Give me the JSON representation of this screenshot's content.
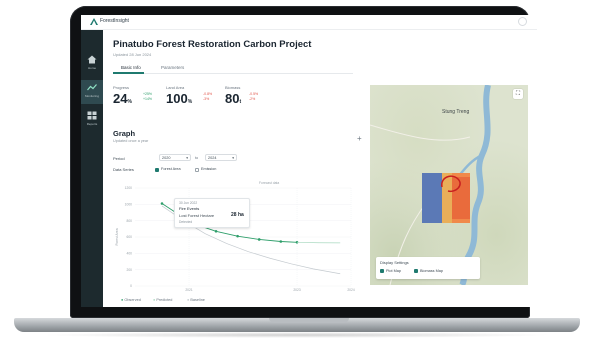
{
  "app": {
    "brand": "ForestInsight",
    "nav": [
      {
        "label": "Home",
        "icon": "home-icon",
        "active": false
      },
      {
        "label": "Monitoring",
        "icon": "chart-icon",
        "active": true
      },
      {
        "label": "Reports",
        "icon": "grid-icon",
        "active": false
      }
    ]
  },
  "project": {
    "title": "Pinatubo Forest Restoration Carbon Project",
    "updated": "Updated 28 Jun 2024"
  },
  "tabs": [
    {
      "label": "Basic Info",
      "active": true
    },
    {
      "label": "Parameters",
      "active": false
    }
  ],
  "metrics": [
    {
      "label": "Progress",
      "value": "24",
      "unit": "%",
      "deltas": [
        {
          "text": "+25%",
          "dir": "up"
        },
        {
          "text": "+14%",
          "dir": "up"
        }
      ]
    },
    {
      "label": "Land Area",
      "value": "100",
      "unit": "%",
      "deltas": [
        {
          "text": "-0.8%",
          "dir": "down"
        },
        {
          "text": "-3%",
          "dir": "down"
        }
      ]
    },
    {
      "label": "Biomass",
      "value": "80",
      "unit": "t",
      "deltas": [
        {
          "text": "-0.5%",
          "dir": "down"
        },
        {
          "text": "-2%",
          "dir": "down"
        }
      ]
    }
  ],
  "graph": {
    "title": "Graph",
    "subtitle": "Updated once a year",
    "add_label": "+",
    "period_label": "Period",
    "period_from": "2020",
    "period_to_word": "to",
    "period_to": "2024",
    "data_series_label": "Data Series",
    "series_options": [
      {
        "label": "Forest Area",
        "checked": true
      },
      {
        "label": "Emission",
        "checked": false
      }
    ],
    "note": "Forecast data",
    "tooltip": {
      "date": "30 Jun 2022",
      "title": "Fire Events",
      "name": "Lost Forest Hectare",
      "value": "28 ha",
      "sub": "Detected"
    },
    "legend": [
      "Observed",
      "Predicted",
      "Baseline"
    ]
  },
  "chart_data": {
    "type": "line",
    "ylabel": "Forest Area",
    "ylim": [
      0,
      1200
    ],
    "yticks": [
      "1200",
      "1000",
      "800",
      "600",
      "400",
      "200",
      "0"
    ],
    "xlim": [
      2020,
      2024
    ],
    "xticks": [
      "2021",
      "2023",
      "2024"
    ],
    "series": [
      {
        "name": "Observed",
        "color": "#2e9e6a",
        "x": [
          2020.5,
          2020.8,
          2021.1,
          2021.5,
          2021.9,
          2022.3,
          2022.7,
          2023.0
        ],
        "y": [
          1010,
          880,
          760,
          670,
          610,
          570,
          545,
          535
        ]
      },
      {
        "name": "Predicted",
        "color": "#a9d9c0",
        "x": [
          2023.0,
          2023.4,
          2023.8
        ],
        "y": [
          535,
          530,
          528
        ]
      },
      {
        "name": "Baseline",
        "color": "#c4cacf",
        "x": [
          2020.5,
          2020.9,
          2021.3,
          2021.7,
          2022.1,
          2022.5,
          2022.9,
          2023.3,
          2023.8
        ],
        "y": [
          980,
          800,
          640,
          520,
          420,
          340,
          270,
          210,
          150
        ]
      }
    ]
  },
  "map": {
    "place": "Stung Treng",
    "expand": "⛶",
    "display_title": "Display Settings",
    "display_options": [
      "Plot Map",
      "Biomass Map"
    ]
  },
  "colors": {
    "accent": "#1f7a6f",
    "up": "#2e9e6a",
    "down": "#e0544a",
    "sidebar": "#1d2a2e"
  }
}
